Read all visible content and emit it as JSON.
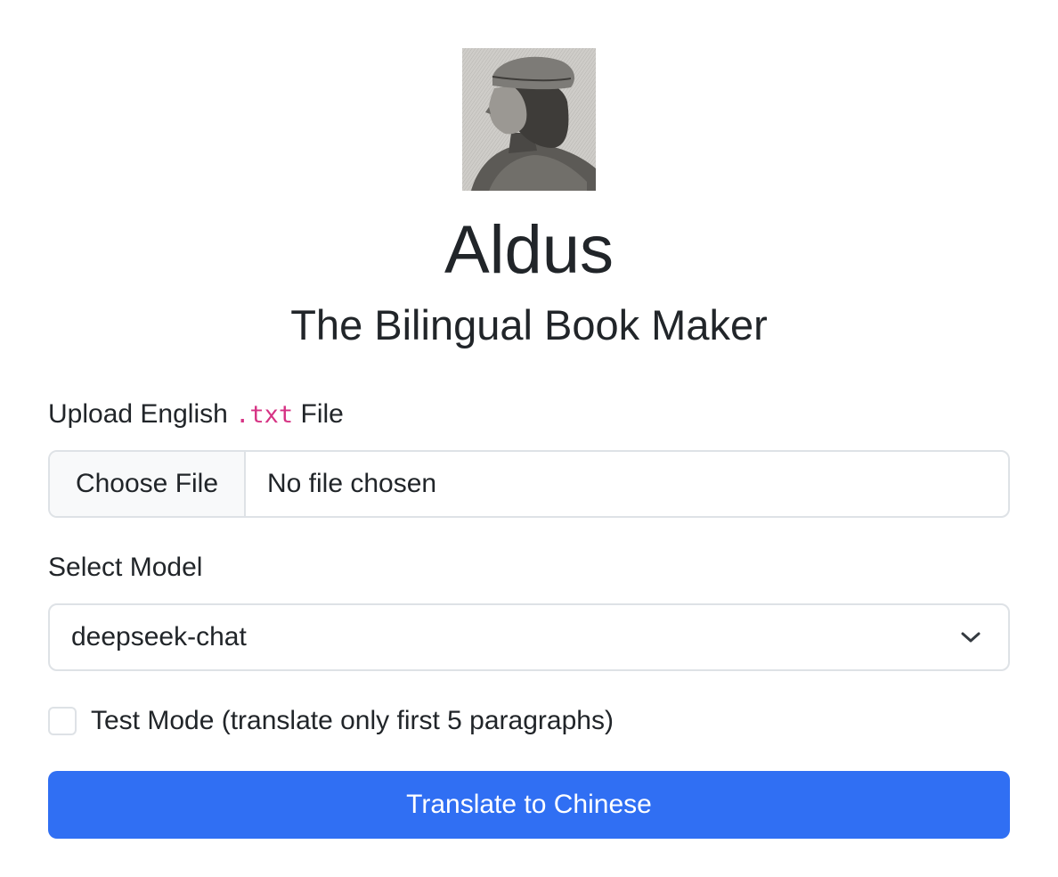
{
  "header": {
    "portrait_icon": "aldus-manutius-portrait",
    "title": "Aldus",
    "subtitle": "The Bilingual Book Maker"
  },
  "upload": {
    "label_prefix": "Upload English",
    "label_ext": ".txt",
    "label_suffix": "File",
    "button_label": "Choose File",
    "status": "No file chosen"
  },
  "model": {
    "label": "Select Model",
    "selected": "deepseek-chat",
    "icon": "chevron-down-icon"
  },
  "test_mode": {
    "label": "Test Mode (translate only first 5 paragraphs)",
    "checked": false
  },
  "submit": {
    "label": "Translate to Chinese",
    "color": "#306ff3"
  },
  "colors": {
    "text": "#212529",
    "border": "#dee2e6",
    "code": "#d63384",
    "accent": "#306ff3"
  }
}
